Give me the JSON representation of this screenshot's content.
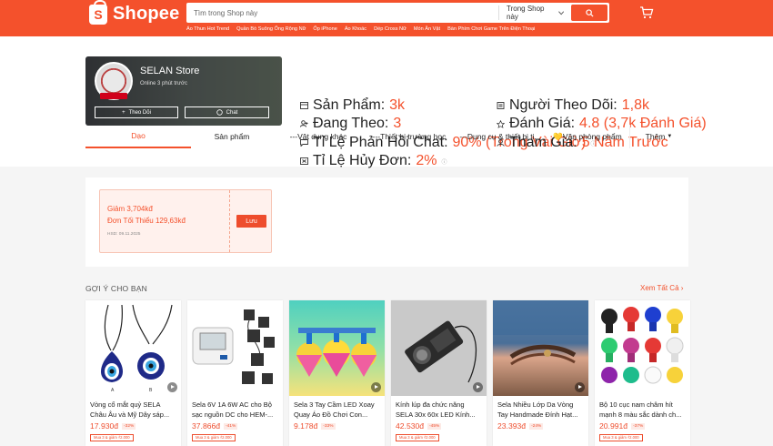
{
  "header": {
    "logo_text": "Shopee",
    "search_placeholder": "Tìm trong Shop này",
    "search_scope": "Trong Shop này",
    "suggestions": [
      "Áo Thun Hot Trend",
      "Quần Bò Suông Ống Rộng Nữ",
      "Ốp iPhone",
      "Áo Khoác",
      "Dép Cross Nữ",
      "Món Ăn Vặt",
      "Bàn Phím Chơi Game Trên Điện Thoại"
    ]
  },
  "shop": {
    "name": "SELAN Store",
    "online": "Online 3 phút trước",
    "follow_label": "Theo Dõi",
    "chat_label": "Chat",
    "stats": {
      "products_label": "Sản Phẩm:",
      "products_value": "3k",
      "following_label": "Đang Theo:",
      "following_value": "3",
      "chat_rate_label": "Tỉ Lệ Phản Hồi Chat:",
      "chat_rate_value": "90% (Trong Vài Giờ)",
      "cancel_rate_label": "Tỉ Lệ Hủy Đơn:",
      "cancel_rate_value": "2%",
      "followers_label": "Người Theo Dõi:",
      "followers_value": "1,8k",
      "rating_label": "Đánh Giá:",
      "rating_value": "4.8 (3,7k Đánh Giá)",
      "joined_label": "Tham Gia:",
      "joined_value": "5 Năm Trước"
    }
  },
  "tabs": [
    "Dạo",
    "Sản phẩm",
    "---Vật dụng khác",
    "---Thiết bị trường học",
    "---Dụng cụ & thiết bị ti...",
    "💛Văn phòng phẩm",
    "Thêm"
  ],
  "voucher": {
    "line1": "Giảm 3,704kđ",
    "line2": "Đơn Tối Thiểu 129,63kđ",
    "expiry": "HSD: 09.11.2025",
    "save_label": "Lưu"
  },
  "recommend": {
    "title": "GỢI Ý CHO BẠN",
    "see_all": "Xem Tất Cả"
  },
  "products": [
    {
      "name": "Vòng cổ mắt quỷ SELA Châu Âu và Mỹ Dây sáp...",
      "price": "17.930đ",
      "discount": "-32%",
      "promo": "Mua 3 & giảm ₫2.000"
    },
    {
      "name": "Sela 6V 1A 6W AC cho Bộ sạc nguồn DC cho HEM-...",
      "price": "37.866đ",
      "discount": "-41%",
      "promo": "Mua 3 & giảm ₫2.000"
    },
    {
      "name": "Sela 3 Tay Cầm LED Xoay Quay Áo Đồ Chơi Con...",
      "price": "9.178đ",
      "discount": "-33%",
      "promo": ""
    },
    {
      "name": "Kính lúp đa chức năng SELA 30x 60x LED Kính...",
      "price": "42.530đ",
      "discount": "-45%",
      "promo": "Mua 3 & giảm ₫2.000"
    },
    {
      "name": "Sela Nhiều Lớp Da Vòng Tay Handmade Đính Hạt...",
      "price": "23.393đ",
      "discount": "-24%",
      "promo": ""
    },
    {
      "name": "Bộ 10 cục nam châm hít mạnh 8 màu sắc dành ch...",
      "price": "20.991đ",
      "discount": "-37%",
      "promo": "Mua 3 & giảm ₫2.000"
    }
  ],
  "colors": {
    "brand": "#f4512c",
    "price": "#ee4d2d"
  }
}
